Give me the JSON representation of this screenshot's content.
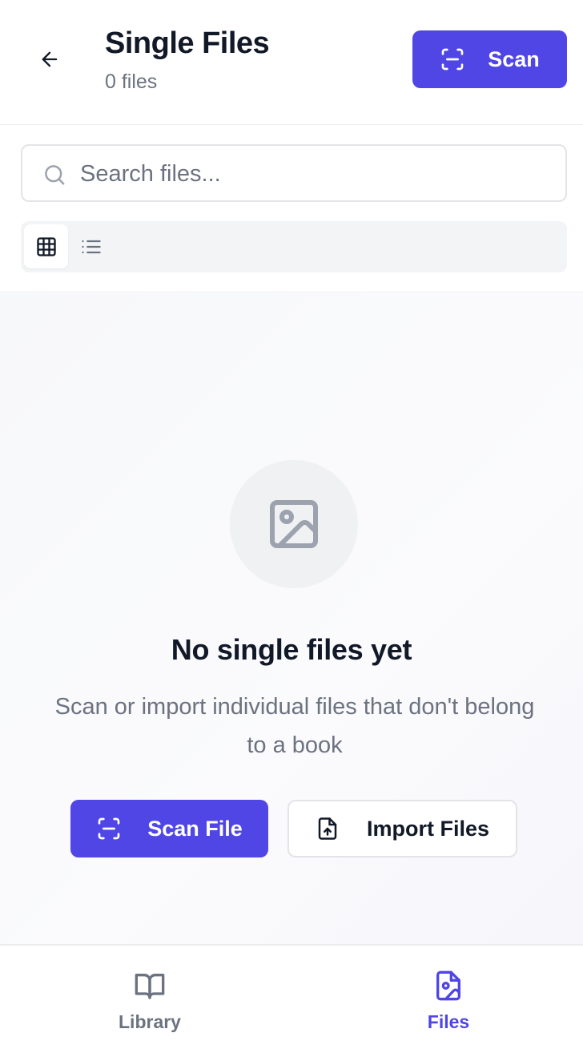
{
  "header": {
    "title": "Single Files",
    "subtitle": "0 files",
    "scan_label": "Scan"
  },
  "search": {
    "placeholder": "Search files...",
    "value": ""
  },
  "view_toggle": {
    "options": [
      "grid",
      "list"
    ],
    "selected": "grid"
  },
  "empty_state": {
    "icon": "image-icon",
    "title": "No single files yet",
    "description": "Scan or import individual files that don't belong to a book",
    "scan_file_label": "Scan File",
    "import_files_label": "Import Files"
  },
  "bottom_nav": {
    "items": [
      {
        "label": "Library",
        "icon": "book-open-icon",
        "active": false
      },
      {
        "label": "Files",
        "icon": "file-image-icon",
        "active": true
      }
    ]
  },
  "colors": {
    "accent": "#4f46e5",
    "text_primary": "#111827",
    "text_muted": "#6b7280"
  }
}
